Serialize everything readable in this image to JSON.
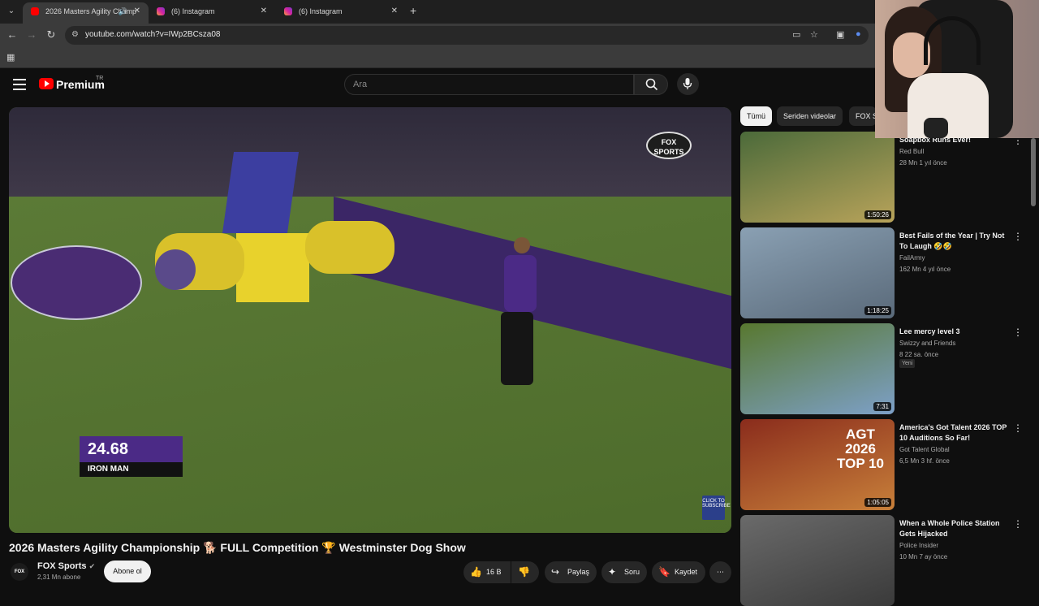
{
  "browser": {
    "tabs": [
      {
        "label": "2026 Masters Agility Champ",
        "active": true,
        "favicon": "youtube-icon"
      },
      {
        "label": "(6) Instagram",
        "active": false,
        "favicon": "instagram-icon"
      },
      {
        "label": "(6) Instagram",
        "active": false,
        "favicon": "instagram-icon"
      }
    ],
    "url": "youtube.com/watch?v=IWp2BCsza08"
  },
  "youtube": {
    "brand": "Premium",
    "country": "TR",
    "search_placeholder": "Ara"
  },
  "video": {
    "title": "2026 Masters Agility Championship 🐕 FULL Competition 🏆 Westminster Dog Show",
    "timer": "24.68",
    "dog_name": "IRON MAN",
    "broadcaster": "FOX SPORTS",
    "subscribe_badge": "CLICK TO SUBSCRIBE"
  },
  "channel": {
    "name": "FOX Sports",
    "avatar_text": "FOX",
    "subscribers": "2,31 Mn abone",
    "subscribe_label": "Abone ol"
  },
  "actions": {
    "likes": "16 B",
    "share": "Paylaş",
    "ask": "Soru",
    "save": "Kaydet"
  },
  "chips": [
    "Tümü",
    "Seriden videolar",
    "FOX S"
  ],
  "recommendations": [
    {
      "title": "Soapbox Runs Ever!",
      "channel": "Red Bull",
      "meta": "28 Mn  1 yıl önce",
      "duration": "1:50:26",
      "colors": [
        "#4b6a3a",
        "#b8a35a"
      ]
    },
    {
      "title": "Best Fails of the Year | Try Not To Laugh 🤣🤣",
      "channel": "FailArmy",
      "meta": "162 Mn  4 yıl önce",
      "duration": "1:18:25",
      "colors": [
        "#8aa0b3",
        "#5a6a7a"
      ]
    },
    {
      "title": "Lee mercy level 3",
      "channel": "Swizzy and Friends",
      "meta": "8  22 sa. önce",
      "duration": "7:31",
      "badge": "Yeni",
      "colors": [
        "#58782f",
        "#7da0c8"
      ]
    },
    {
      "title": "America's Got Talent 2026 TOP 10 Auditions So Far!",
      "channel": "Got Talent Global",
      "meta": "6,5 Mn  3 hf. önce",
      "duration": "1:05:05",
      "overlay": "AGT 2026 TOP 10",
      "colors": [
        "#8a2c1c",
        "#c8803a"
      ]
    },
    {
      "title": "When a Whole Police Station Gets Hijacked",
      "channel": "Police Insider",
      "meta": "10 Mn  7 ay önce",
      "duration": "",
      "colors": [
        "#6a6a6a",
        "#3a3a3a"
      ]
    }
  ]
}
